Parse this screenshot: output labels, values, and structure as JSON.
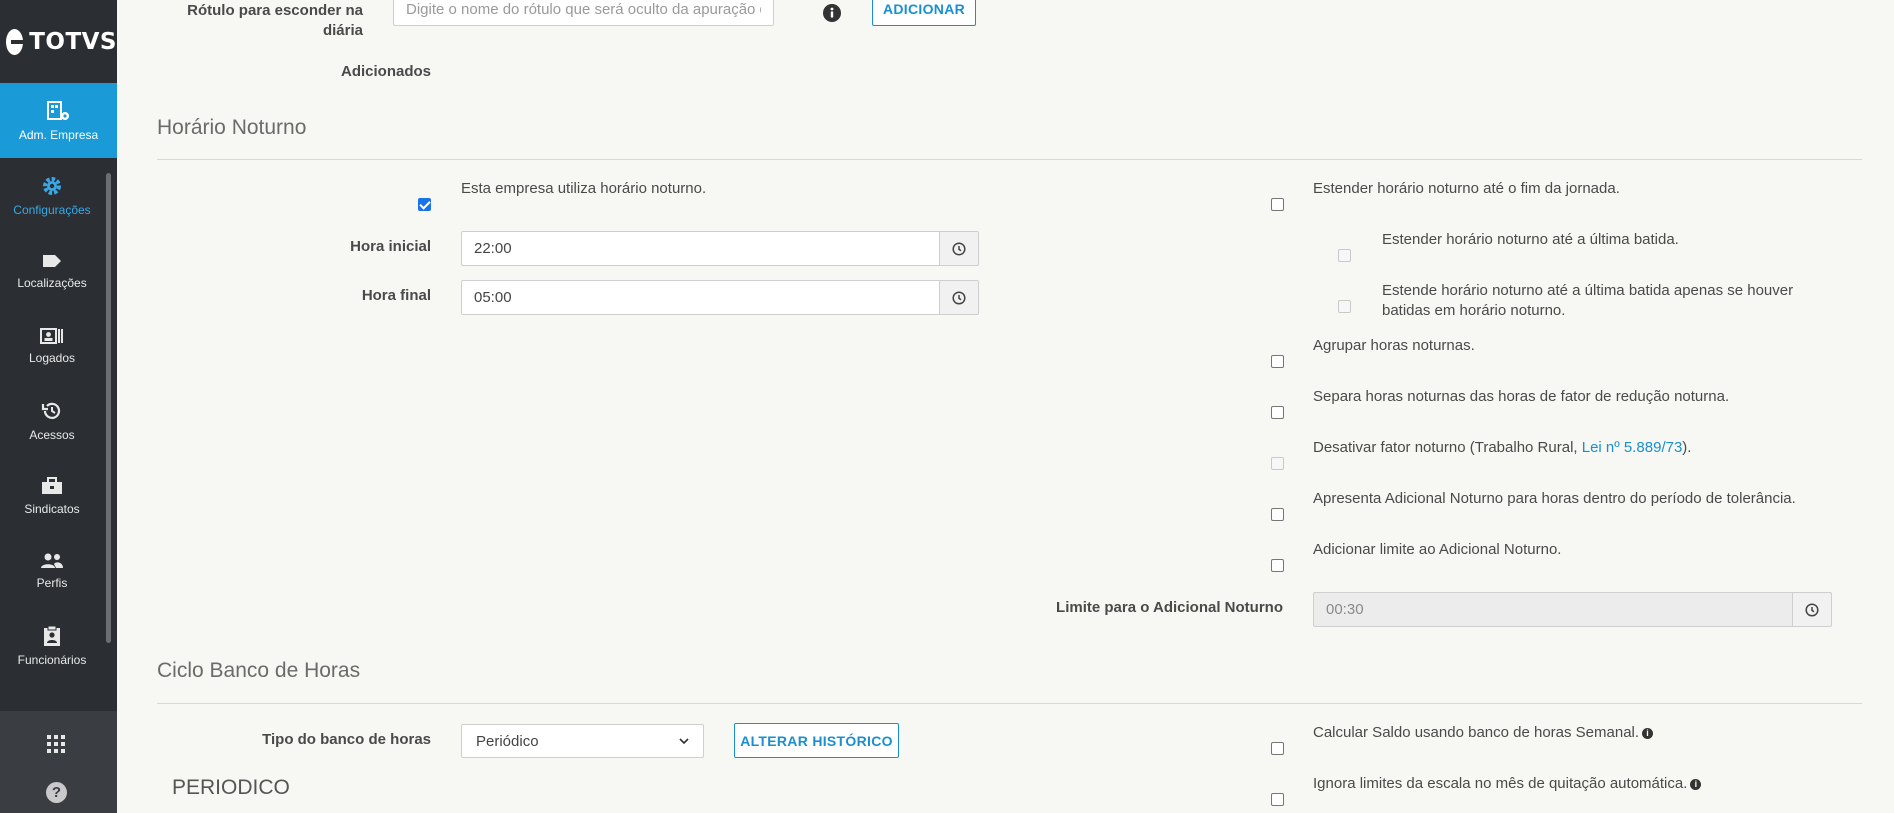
{
  "brand": {
    "logo_text": "TOTVS"
  },
  "sidebar": {
    "items": [
      {
        "label": "Adm. Empresa",
        "icon": "building-gear-icon"
      },
      {
        "label": "Configurações",
        "icon": "gear-icon"
      },
      {
        "label": "Localizações",
        "icon": "tag-icon"
      },
      {
        "label": "Logados",
        "icon": "id-card-icon"
      },
      {
        "label": "Acessos",
        "icon": "history-icon"
      },
      {
        "label": "Sindicatos",
        "icon": "briefcase-icon"
      },
      {
        "label": "Perfis",
        "icon": "users-icon"
      },
      {
        "label": "Funcionários",
        "icon": "clipboard-user-icon"
      }
    ],
    "bottom": {
      "apps_icon": "grid-icon",
      "help_label": "?"
    }
  },
  "hide_label": {
    "label": "Rótulo para esconder na diária",
    "placeholder": "Digite o nome do rótulo que será oculto da apuração d",
    "add_button": "ADICIONAR",
    "added_label": "Adicionados"
  },
  "night": {
    "title": "Horário Noturno",
    "uses_night": {
      "label": "Esta empresa utiliza horário noturno.",
      "checked": true
    },
    "start_label": "Hora inicial",
    "start_value": "22:00",
    "end_label": "Hora final",
    "end_value": "05:00",
    "options": {
      "extend_end": "Estender horário noturno até o fim da jornada.",
      "extend_last": "Estender horário noturno até a última batida.",
      "extend_last_if": "Estende horário noturno até a última batida apenas se houver batidas em horário noturno.",
      "group": "Agrupar horas noturnas.",
      "separate": "Separa horas noturnas das horas de fator de redução noturna.",
      "disable_prefix": "Desativar fator noturno (Trabalho Rural, ",
      "disable_link": "Lei nº 5.889/73",
      "disable_suffix": ").",
      "tolerance": "Apresenta Adicional Noturno para horas dentro do período de tolerância.",
      "limit": "Adicionar limite ao Adicional Noturno."
    },
    "limit_label": "Limite para o Adicional Noturno",
    "limit_value": "00:30"
  },
  "bank": {
    "title": "Ciclo Banco de Horas",
    "type_label": "Tipo do banco de horas",
    "type_value": "Periódico",
    "history_button": "ALTERAR HISTÓRICO",
    "subtitle": "PERIODICO",
    "weekly": "Calcular Saldo usando banco de horas Semanal.",
    "ignore_limits": "Ignora limites da escala no mês de quitação automática."
  }
}
